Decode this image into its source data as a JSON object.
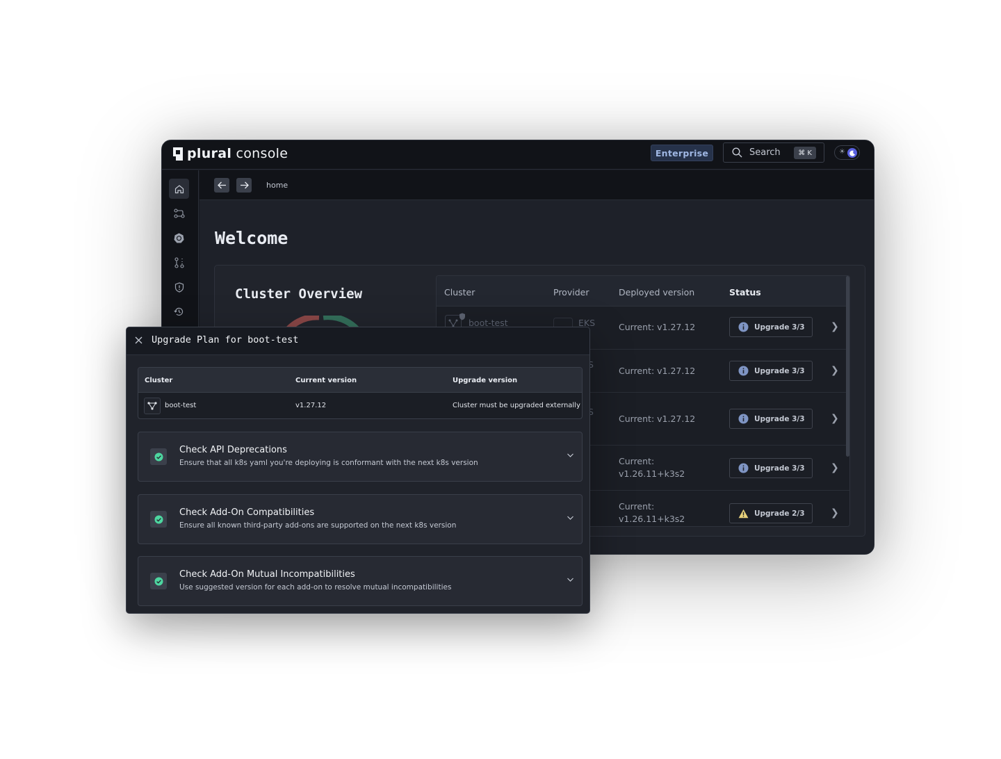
{
  "app": {
    "logo_bold": "plural",
    "logo_light": " console"
  },
  "topbar": {
    "enterprise_label": "Enterprise",
    "search_label": "Search",
    "search_shortcut": "⌘ K"
  },
  "breadcrumb": {
    "current": "home"
  },
  "page": {
    "title": "Welcome"
  },
  "overview": {
    "title": "Cluster Overview",
    "table": {
      "headers": {
        "cluster": "Cluster",
        "provider": "Provider",
        "version": "Deployed version",
        "status": "Status"
      },
      "rows": [
        {
          "cluster": "boot-test",
          "provider": "EKS",
          "version_line1": "Current: v1.27.12",
          "version_line2": "",
          "status": "Upgrade 3/3",
          "status_kind": "info"
        },
        {
          "cluster": "",
          "provider": "",
          "version_line1": "Current: v1.27.12",
          "version_line2": "",
          "status": "Upgrade 3/3",
          "status_kind": "info"
        },
        {
          "cluster": "",
          "provider": "",
          "version_line1": "Current: v1.27.12",
          "version_line2": "",
          "status": "Upgrade 3/3",
          "status_kind": "info"
        },
        {
          "cluster": "",
          "provider": "",
          "version_line1": "Current:",
          "version_line2": "v1.26.11+k3s2",
          "status": "Upgrade 3/3",
          "status_kind": "info"
        },
        {
          "cluster": "",
          "provider": "",
          "version_line1": "Current:",
          "version_line2": "v1.26.11+k3s2",
          "status": "Upgrade 2/3",
          "status_kind": "warning"
        }
      ]
    }
  },
  "modal": {
    "title": "Upgrade Plan for boot-test",
    "table": {
      "headers": {
        "cluster": "Cluster",
        "current": "Current version",
        "upgrade": "Upgrade version"
      },
      "row": {
        "cluster": "boot-test",
        "current": "v1.27.12",
        "upgrade": "Cluster must be upgraded externally"
      }
    },
    "checks": [
      {
        "title": "Check API Deprecations",
        "description": "Ensure that all k8s yaml you're deploying is conformant with the next k8s version"
      },
      {
        "title": "Check Add-On Compatibilities",
        "description": "Ensure all known third-party add-ons are supported on the next k8s version"
      },
      {
        "title": "Check Add-On Mutual Incompatibilities",
        "description": "Use suggested version for each add-on to resolve mutual incompatibilities"
      }
    ]
  },
  "colors": {
    "accent": "#5a61e0",
    "success": "#4dd6a0",
    "info": "#7f95c4",
    "warning": "#e8d27b",
    "donut_red": "#c15a5a",
    "donut_green": "#3e9e78"
  }
}
